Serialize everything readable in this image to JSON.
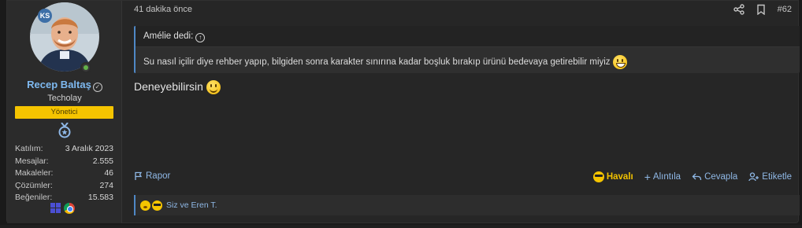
{
  "user": {
    "avatar_badge": "KS",
    "name": "Recep Baltaş",
    "title": "Techolay",
    "role": "Yönetici",
    "stats": [
      {
        "label": "Katılım:",
        "value": "3 Aralık 2023"
      },
      {
        "label": "Mesajlar:",
        "value": "2.555"
      },
      {
        "label": "Makaleler:",
        "value": "46"
      },
      {
        "label": "Çözümler:",
        "value": "274"
      },
      {
        "label": "Beğeniler:",
        "value": "15.583"
      }
    ],
    "devices": [
      "windows-icon",
      "chrome-icon"
    ]
  },
  "post": {
    "time": "41 dakika önce",
    "number": "#62",
    "quote": {
      "author": "Amélie dedi:",
      "text": "Su nasıl içilir diye rehber yapıp, bilgiden sonra karakter sınırına kadar boşluk bırakıp ürünü bedevaya getirebilir miyiz"
    },
    "message": "Deneyebilirsin"
  },
  "actions": {
    "report": "Rapor",
    "reaction": "Havalı",
    "quote": "Alıntıla",
    "reply": "Cevapla",
    "tag": "Etiketle"
  },
  "reactions": {
    "names": "Siz ve Eren T."
  },
  "colors": {
    "accent": "#4f88c6",
    "link": "#8fb8e6",
    "role_banner": "#f5c400",
    "username": "#7eb9f0",
    "reaction_active": "#f2c200"
  }
}
